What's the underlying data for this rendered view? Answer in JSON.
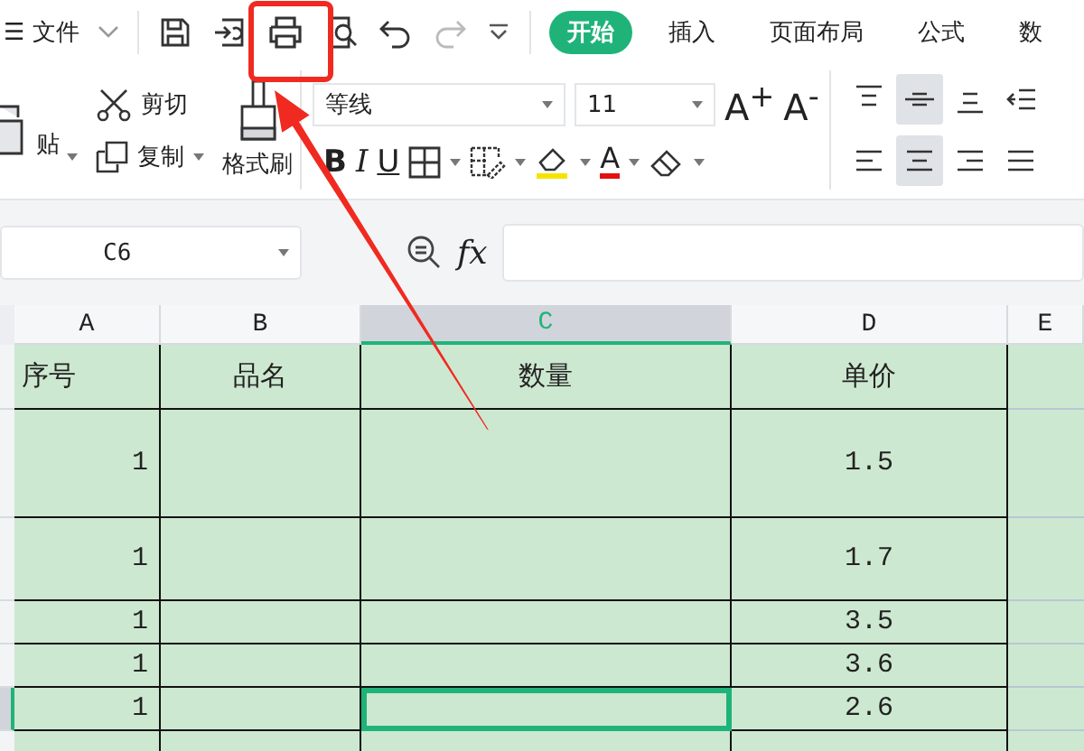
{
  "file_menu": {
    "icon": "☰",
    "label": "文件"
  },
  "tabs": [
    {
      "label": "开始",
      "selected": true
    },
    {
      "label": "插入",
      "selected": false
    },
    {
      "label": "页面布局",
      "selected": false
    },
    {
      "label": "公式",
      "selected": false
    },
    {
      "label": "数",
      "selected": false
    }
  ],
  "clipboard": {
    "paste": "贴",
    "cut": "剪切",
    "copy": "复制",
    "format_painter": "格式刷"
  },
  "font": {
    "name": "等线",
    "size": "11",
    "grow": "A$^{+}$",
    "shrink": "A$^{-}$",
    "bold": "B",
    "italic": "I",
    "underline": "U",
    "color_letter": "A"
  },
  "alignment": [
    {
      "kind": "top",
      "selected": false
    },
    {
      "kind": "middle",
      "selected": true
    },
    {
      "kind": "bottom",
      "selected": false
    },
    {
      "kind": "outdent",
      "selected": false
    },
    {
      "kind": "left",
      "selected": false
    },
    {
      "kind": "center",
      "selected": true
    },
    {
      "kind": "right",
      "selected": false
    },
    {
      "kind": "justify",
      "selected": false
    }
  ],
  "formula_bar": {
    "cell_ref": "C6",
    "fx": "fx"
  },
  "columns": [
    {
      "label": "A",
      "selected": false
    },
    {
      "label": "B",
      "selected": false
    },
    {
      "label": "C",
      "selected": true
    },
    {
      "label": "D",
      "selected": false
    },
    {
      "label": "E",
      "selected": false
    }
  ],
  "header": [
    "序号",
    "品名",
    "数量",
    "单价"
  ],
  "rows": [
    {
      "a": "1",
      "d": "1.5",
      "selected": false
    },
    {
      "a": "1",
      "d": "1.7",
      "selected": false
    },
    {
      "a": "1",
      "d": "3.5",
      "selected": false
    },
    {
      "a": "1",
      "d": "3.6",
      "selected": false
    },
    {
      "a": "1",
      "d": "2.6",
      "selected": true
    }
  ]
}
